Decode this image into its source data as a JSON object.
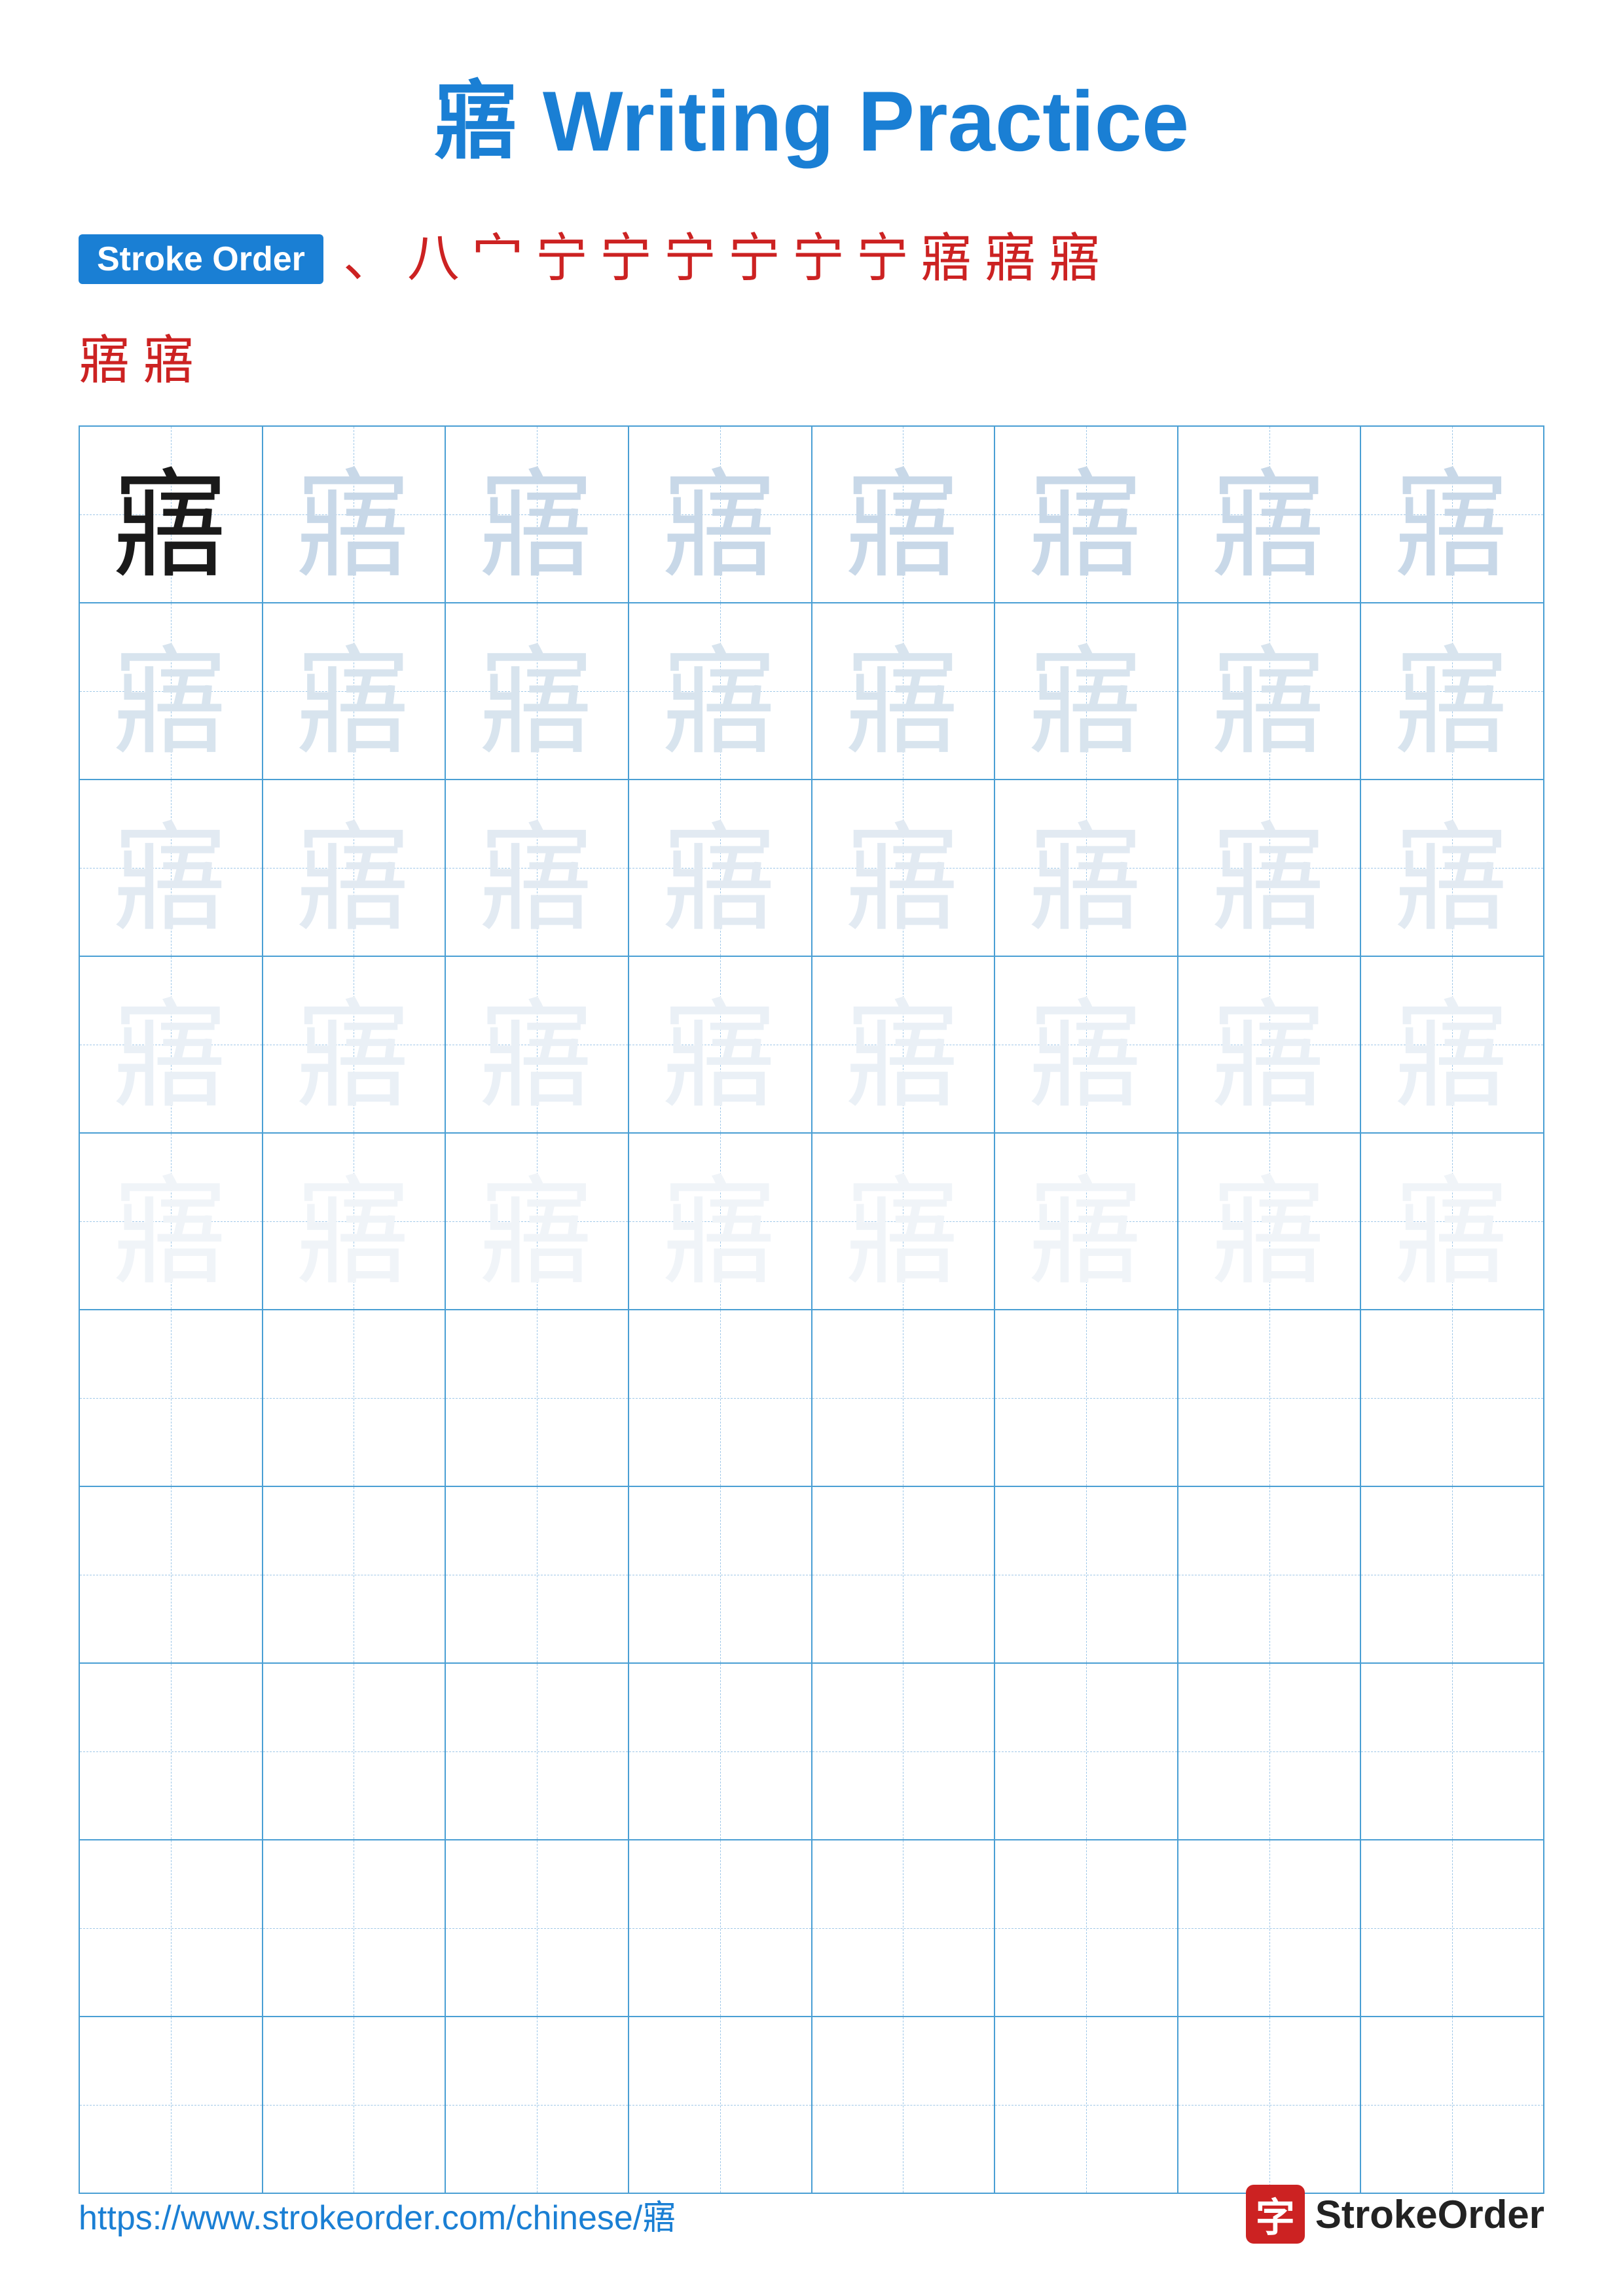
{
  "title": {
    "character": "寤",
    "suffix": " Writing Practice",
    "full": "寤 Writing Practice"
  },
  "stroke_order": {
    "badge_label": "Stroke Order",
    "strokes": [
      "、",
      "八",
      "宀",
      "宁",
      "宁",
      "宁",
      "宁",
      "宁",
      "宁",
      "寤",
      "寤",
      "寤",
      "寤",
      "寤"
    ]
  },
  "character": "寤",
  "grid": {
    "rows": 10,
    "cols": 8
  },
  "footer": {
    "url": "https://www.strokeorder.com/chinese/寤",
    "logo_char": "字",
    "logo_text": "StrokeOrder"
  }
}
